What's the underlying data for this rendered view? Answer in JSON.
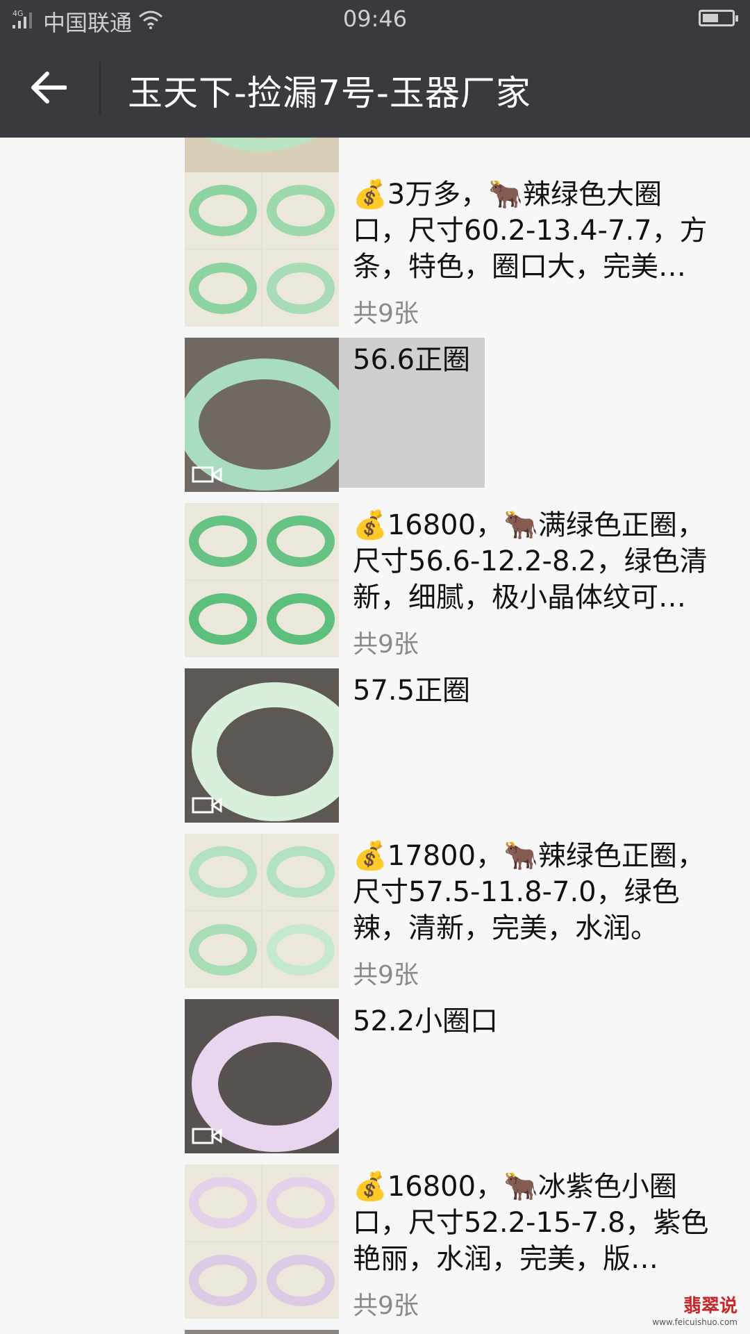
{
  "status": {
    "network": "4G",
    "carrier": "中国联通",
    "time": "09:46",
    "battery_level": 0.55
  },
  "header": {
    "title": "玉天下-捡漏7号-玉器厂家"
  },
  "items": [
    {
      "type": "video",
      "caption": "",
      "count": ""
    },
    {
      "type": "grid",
      "caption": "💰3万多，🐂辣绿色大圈口，尺寸60.2-13.4-7.7，方条，特色，圈口大，完美…",
      "count": "共9张"
    },
    {
      "type": "video",
      "caption": "56.6正圈",
      "count": "",
      "selected": true
    },
    {
      "type": "grid",
      "caption": "💰16800，🐂满绿色正圈，尺寸56.6-12.2-8.2，绿色清新，细腻，极小晶体纹可…",
      "count": "共9张"
    },
    {
      "type": "video",
      "caption": "57.5正圈",
      "count": ""
    },
    {
      "type": "grid",
      "caption": "💰17800，🐂辣绿色正圈，尺寸57.5-11.8-7.0，绿色辣，清新，完美，水润。",
      "count": "共9张"
    },
    {
      "type": "video",
      "caption": "52.2小圈口",
      "count": ""
    },
    {
      "type": "grid",
      "caption": "💰16800，🐂冰紫色小圈口，尺寸52.2-15-7.8，紫色艳丽，水润，完美，版…",
      "count": "共9张"
    }
  ],
  "watermark": {
    "name": "翡翠说",
    "url": "www.feicuishuo.com"
  },
  "colors": {
    "bar": "#393a3f",
    "page": "#f7f7f7",
    "jade_green": "#bfe6c7",
    "lavender": "#e8d6ee"
  }
}
